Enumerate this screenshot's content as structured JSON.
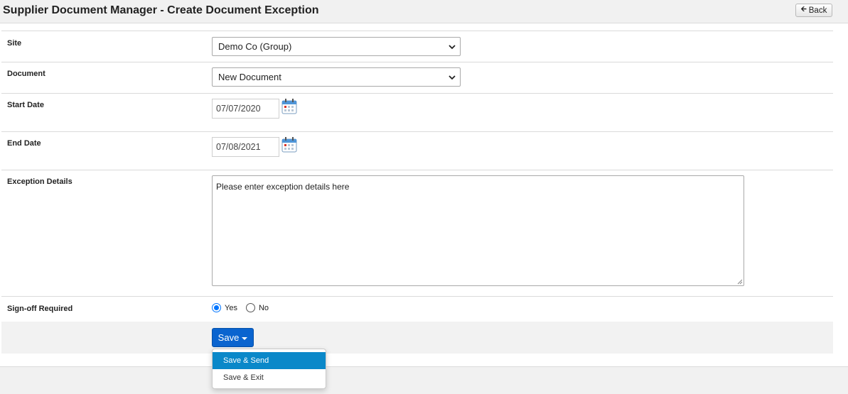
{
  "header": {
    "title": "Supplier Document Manager - Create Document Exception",
    "back_label": "Back"
  },
  "form": {
    "site": {
      "label": "Site",
      "selected": "Demo Co (Group)"
    },
    "document": {
      "label": "Document",
      "selected": "New Document"
    },
    "start_date": {
      "label": "Start Date",
      "value": "07/07/2020"
    },
    "end_date": {
      "label": "End Date",
      "value": "07/08/2021"
    },
    "exception_details": {
      "label": "Exception Details",
      "value": "Please enter exception details here"
    },
    "sign_off": {
      "label": "Sign-off Required",
      "options": [
        {
          "label": "Yes",
          "checked": true
        },
        {
          "label": "No",
          "checked": false
        }
      ]
    }
  },
  "actions": {
    "save_label": "Save",
    "menu": [
      {
        "label": "Save & Send",
        "active": true
      },
      {
        "label": "Save & Exit",
        "active": false
      }
    ]
  },
  "colors": {
    "primary_button": "#0a64cf",
    "menu_highlight": "#0a88c9",
    "radio_accent": "#0075ff"
  },
  "icons": [
    "back-arrow-icon",
    "chevron-down-icon",
    "calendar-icon",
    "caret-down-icon"
  ]
}
